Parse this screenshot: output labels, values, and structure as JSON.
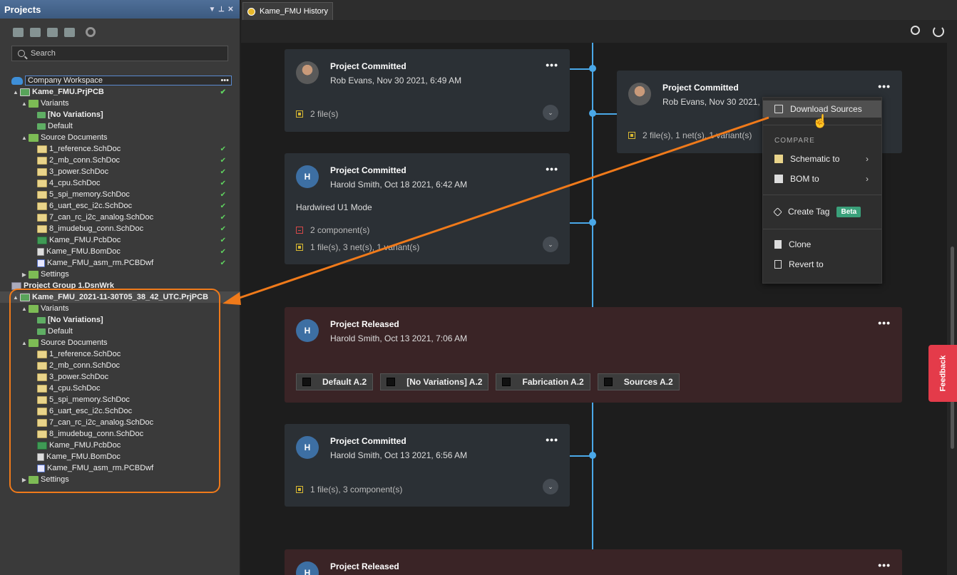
{
  "projects_panel": {
    "title": "Projects",
    "search_placeholder": "Search",
    "workspace": "Company Workspace",
    "tree": [
      {
        "label": "Kame_FMU.PrjPCB",
        "depth": 1,
        "icon": "prj",
        "bold": true,
        "check": true,
        "tri": "▲"
      },
      {
        "label": "Variants",
        "depth": 2,
        "icon": "folder-g",
        "tri": "▲"
      },
      {
        "label": "[No Variations]",
        "depth": 3,
        "icon": "var",
        "bold": true
      },
      {
        "label": "Default",
        "depth": 3,
        "icon": "var"
      },
      {
        "label": "Source Documents",
        "depth": 2,
        "icon": "folder-g",
        "tri": "▲"
      },
      {
        "label": "1_reference.SchDoc",
        "depth": 3,
        "icon": "sch",
        "check": true
      },
      {
        "label": "2_mb_conn.SchDoc",
        "depth": 3,
        "icon": "sch",
        "check": true
      },
      {
        "label": "3_power.SchDoc",
        "depth": 3,
        "icon": "sch",
        "check": true
      },
      {
        "label": "4_cpu.SchDoc",
        "depth": 3,
        "icon": "sch",
        "check": true
      },
      {
        "label": "5_spi_memory.SchDoc",
        "depth": 3,
        "icon": "sch",
        "check": true
      },
      {
        "label": "6_uart_esc_i2c.SchDoc",
        "depth": 3,
        "icon": "sch",
        "check": true
      },
      {
        "label": "7_can_rc_i2c_analog.SchDoc",
        "depth": 3,
        "icon": "sch",
        "check": true
      },
      {
        "label": "8_imudebug_conn.SchDoc",
        "depth": 3,
        "icon": "sch",
        "check": true
      },
      {
        "label": "Kame_FMU.PcbDoc",
        "depth": 3,
        "icon": "pcb",
        "check": true
      },
      {
        "label": "Kame_FMU.BomDoc",
        "depth": 3,
        "icon": "bom",
        "check": true
      },
      {
        "label": "Kame_FMU_asm_rm.PCBDwf",
        "depth": 3,
        "icon": "dwf",
        "check": true
      },
      {
        "label": "Settings",
        "depth": 2,
        "icon": "folder-g",
        "tri": "▶"
      },
      {
        "label": "Project Group 1.DsnWrk",
        "depth": 0,
        "icon": "grp",
        "bold": true
      },
      {
        "label": "Kame_FMU_2021-11-30T05_38_42_UTC.PrjPCB",
        "depth": 1,
        "icon": "prj",
        "bold": true,
        "sel": true,
        "tri": "▲"
      },
      {
        "label": "Variants",
        "depth": 2,
        "icon": "folder-g",
        "tri": "▲"
      },
      {
        "label": "[No Variations]",
        "depth": 3,
        "icon": "var",
        "bold": true
      },
      {
        "label": "Default",
        "depth": 3,
        "icon": "var"
      },
      {
        "label": "Source Documents",
        "depth": 2,
        "icon": "folder-g",
        "tri": "▲"
      },
      {
        "label": "1_reference.SchDoc",
        "depth": 3,
        "icon": "sch"
      },
      {
        "label": "2_mb_conn.SchDoc",
        "depth": 3,
        "icon": "sch"
      },
      {
        "label": "3_power.SchDoc",
        "depth": 3,
        "icon": "sch"
      },
      {
        "label": "4_cpu.SchDoc",
        "depth": 3,
        "icon": "sch"
      },
      {
        "label": "5_spi_memory.SchDoc",
        "depth": 3,
        "icon": "sch"
      },
      {
        "label": "6_uart_esc_i2c.SchDoc",
        "depth": 3,
        "icon": "sch"
      },
      {
        "label": "7_can_rc_i2c_analog.SchDoc",
        "depth": 3,
        "icon": "sch"
      },
      {
        "label": "8_imudebug_conn.SchDoc",
        "depth": 3,
        "icon": "sch"
      },
      {
        "label": "Kame_FMU.PcbDoc",
        "depth": 3,
        "icon": "pcb"
      },
      {
        "label": "Kame_FMU.BomDoc",
        "depth": 3,
        "icon": "bom"
      },
      {
        "label": "Kame_FMU_asm_rm.PCBDwf",
        "depth": 3,
        "icon": "dwf"
      },
      {
        "label": "Settings",
        "depth": 2,
        "icon": "folder-g",
        "tri": "▶"
      }
    ]
  },
  "tab": {
    "label": "Kame_FMU History"
  },
  "cards": {
    "c1": {
      "title": "Project Committed",
      "meta": "Rob Evans, Nov 30 2021, 6:49 AM",
      "files": "2 file(s)"
    },
    "c2": {
      "title": "Project Committed",
      "meta": "Rob Evans, Nov 30 2021,",
      "files": "2 file(s), 1 net(s), 1 variant(s)"
    },
    "c3": {
      "title": "Project Committed",
      "meta": "Harold Smith, Oct 18 2021, 6:42 AM",
      "avatar": "H",
      "message": "Hardwired U1 Mode",
      "components": "2 component(s)",
      "files": "1 file(s), 3 net(s), 1 variant(s)"
    },
    "c4": {
      "title": "Project Released",
      "meta": "Harold Smith, Oct 13 2021, 7:06 AM",
      "avatar": "H",
      "tags": [
        "Default A.2",
        "[No Variations] A.2",
        "Fabrication A.2",
        "Sources A.2"
      ]
    },
    "c5": {
      "title": "Project Committed",
      "meta": "Harold Smith, Oct 13 2021, 6:56 AM",
      "avatar": "H",
      "files": "1 file(s), 3 component(s)"
    },
    "c6": {
      "title": "Project Released",
      "avatar": "H"
    }
  },
  "menu": {
    "download": "Download Sources",
    "compare_section": "COMPARE",
    "schematic": "Schematic to",
    "bom": "BOM to",
    "create_tag": "Create Tag",
    "beta": "Beta",
    "clone": "Clone",
    "revert": "Revert to"
  },
  "feedback": "Feedback",
  "colors": {
    "timeline": "#4aa8e8",
    "highlight": "#f07a1a",
    "feedback": "#e43b4a",
    "beta": "#3aa07a"
  }
}
